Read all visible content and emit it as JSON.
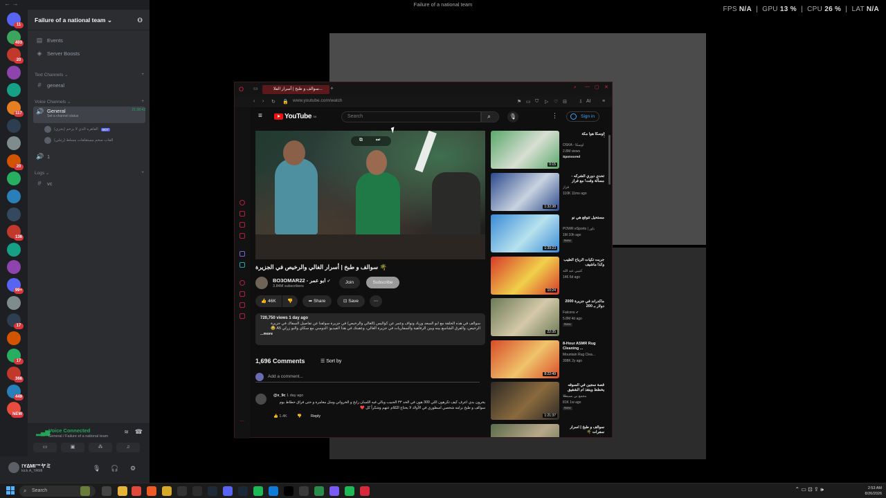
{
  "overlay": {
    "window_title": "Failure of a national team",
    "perf": {
      "fps_label": "FPS",
      "fps": "N/A",
      "gpu_label": "GPU",
      "gpu": "13 %",
      "cpu_label": "CPU",
      "cpu": "26 %",
      "lat_label": "LAT",
      "lat": "N/A"
    }
  },
  "discord": {
    "server_badges": [
      "11",
      "403",
      "20",
      "",
      "",
      "117",
      "",
      "",
      "20",
      "",
      "",
      "",
      "136",
      "",
      "",
      "99+",
      "",
      "17",
      "",
      "17",
      "366",
      "449",
      "NEW"
    ],
    "guild_name": "Failure of a national team",
    "top_items": [
      "Events",
      "Server Boosts"
    ],
    "categories": {
      "text": "Text Channels",
      "voice": "Voice Channels",
      "logs": "Logs"
    },
    "text_channels": [
      "general"
    ],
    "voice_channel": {
      "name": "General",
      "time": "21:38:43",
      "status": "Set a channel status"
    },
    "voice_members": [
      {
        "name": "القاهره الذي لا يرحم (بحري)",
        "tag": "BOT"
      },
      {
        "name": "القاب صخم مستقلقات مسلط (رتبلي)",
        "tag": ""
      }
    ],
    "voice_channel2": "1",
    "logs_channels": [
      "vc"
    ],
    "voice_panel": {
      "title": "Voice Connected",
      "subtitle": "General / Failure of a national team"
    },
    "user": {
      "name": "!Y∆MI™ヤミ",
      "status": "kick A_YAMI"
    }
  },
  "browser": {
    "tab_title": "سوالف و طبخ | أسرار الفلا...",
    "url": "www.youtube.com/watch",
    "extensions_label": "AI"
  },
  "youtube": {
    "search_placeholder": "Search",
    "logo_text": "YouTube",
    "logo_region": "SA",
    "signin": "Sign in",
    "video_title": "سوالف و طبخ | أسرار الغالي والرخيص في الجزيرة 🌴",
    "channel_name": "BO3OMAR22 - ابو عمر",
    "subscribers": "3.84M subscribers",
    "join": "Join",
    "subscribe": "Subscribe",
    "likes": "46K",
    "share": "Share",
    "save": "Save",
    "views_date": "720,750 views  1 day ago",
    "description": "سوالف في هذه الحلقة مع أبو السعد وزياد ونواف وعمر عن كواليس (الغالي والرخيص) في جزيرة سولفنا عن تفاصيل السفاك في جزيرة الرخيص، والفرق الشاسع بينه وبين الرفاهية والسفاريات في جزيرة الغالي، وعقبتك في هذا الفيديو: الدوسي مع سكاي والبو زرلي A5 😂",
    "more": "...more",
    "comments_count": "1,696 Comments",
    "sort_by": "Sort by",
    "add_comment": "Add a comment...",
    "comment": {
      "author": "@x_9c",
      "time": "1 day ago",
      "text": "يخرون بدي اعرف كيف تكرهون اللي 300 هون في الحد ٣٣ الحبيب وبالي فيه اللسان رايح و الخرواني ومثل مغامرة و حتى فراق حطاط بوم سوالف و طبخ برامه شخصي اسطوري في الأولاد لا يحتاج الكلام عنهم وشكراً كل ❤️",
      "likes": "1.4K",
      "reply": "Reply"
    },
    "recommendations": [
      {
        "title": "أوسكا هوا مكة",
        "channel": "OSKA - اوسكا",
        "meta": "2.8M views",
        "badge": "Sponsored",
        "duration": "0:15",
        "c1": "#5aa86a",
        "c2": "#d8dfd3"
      },
      {
        "title": "تحدي دوري الشركه - مسألة وقت! مع فراز",
        "channel": "فراز",
        "meta": "110K  11mo ago",
        "badge": "",
        "duration": "1:32:38",
        "c1": "#2c4a8c",
        "c2": "#c9d3e0"
      },
      {
        "title": "مستحيل تتوقع هي نو",
        "channel": "POWR eSports | باور",
        "meta": "1M  10h ago",
        "badge": "New",
        "duration": "1:39:23",
        "c1": "#3a8ad6",
        "c2": "#b7e2ee"
      },
      {
        "title": "جربت تكيات الرياح الطيب وكذا ماشيف",
        "channel": "كتيبي عبد الله",
        "meta": "146  6d ago",
        "badge": "",
        "duration": "10:24",
        "c1": "#d63a2b",
        "c2": "#f1d04b"
      },
      {
        "title": "ماكدراند في جزيرة 2000 دولار بـ 200",
        "channel": "Falcons ✔",
        "meta": "5.8M  4d ago",
        "badge": "New",
        "duration": "22:35",
        "c1": "#6c7a57",
        "c2": "#d4c9a8"
      },
      {
        "title": "8-Hour ASMR Rug Cleaning ...",
        "channel": "Mountain Rug Clea...",
        "meta": "308K  2y ago",
        "badge": "",
        "duration": "8:22:49",
        "c1": "#d84c2a",
        "c2": "#f0c36a"
      },
      {
        "title": "قصة سجين في السوقه يخطط وينقذ ام الشقيق",
        "channel": "مجمع بي بسيطلا",
        "meta": "81K  1w ago",
        "badge": "New",
        "duration": "1:21:37",
        "c1": "#2e2a26",
        "c2": "#8a6a3e"
      },
      {
        "title": "سوالف و طبخ | أسرار سفرات 🌴",
        "channel": "",
        "meta": "",
        "badge": "",
        "duration": "",
        "c1": "#5a6b4c",
        "c2": "#b9a88a"
      }
    ]
  },
  "taskbar": {
    "search": "Search",
    "time": "2:53 AM",
    "date": "8/26/2026"
  }
}
